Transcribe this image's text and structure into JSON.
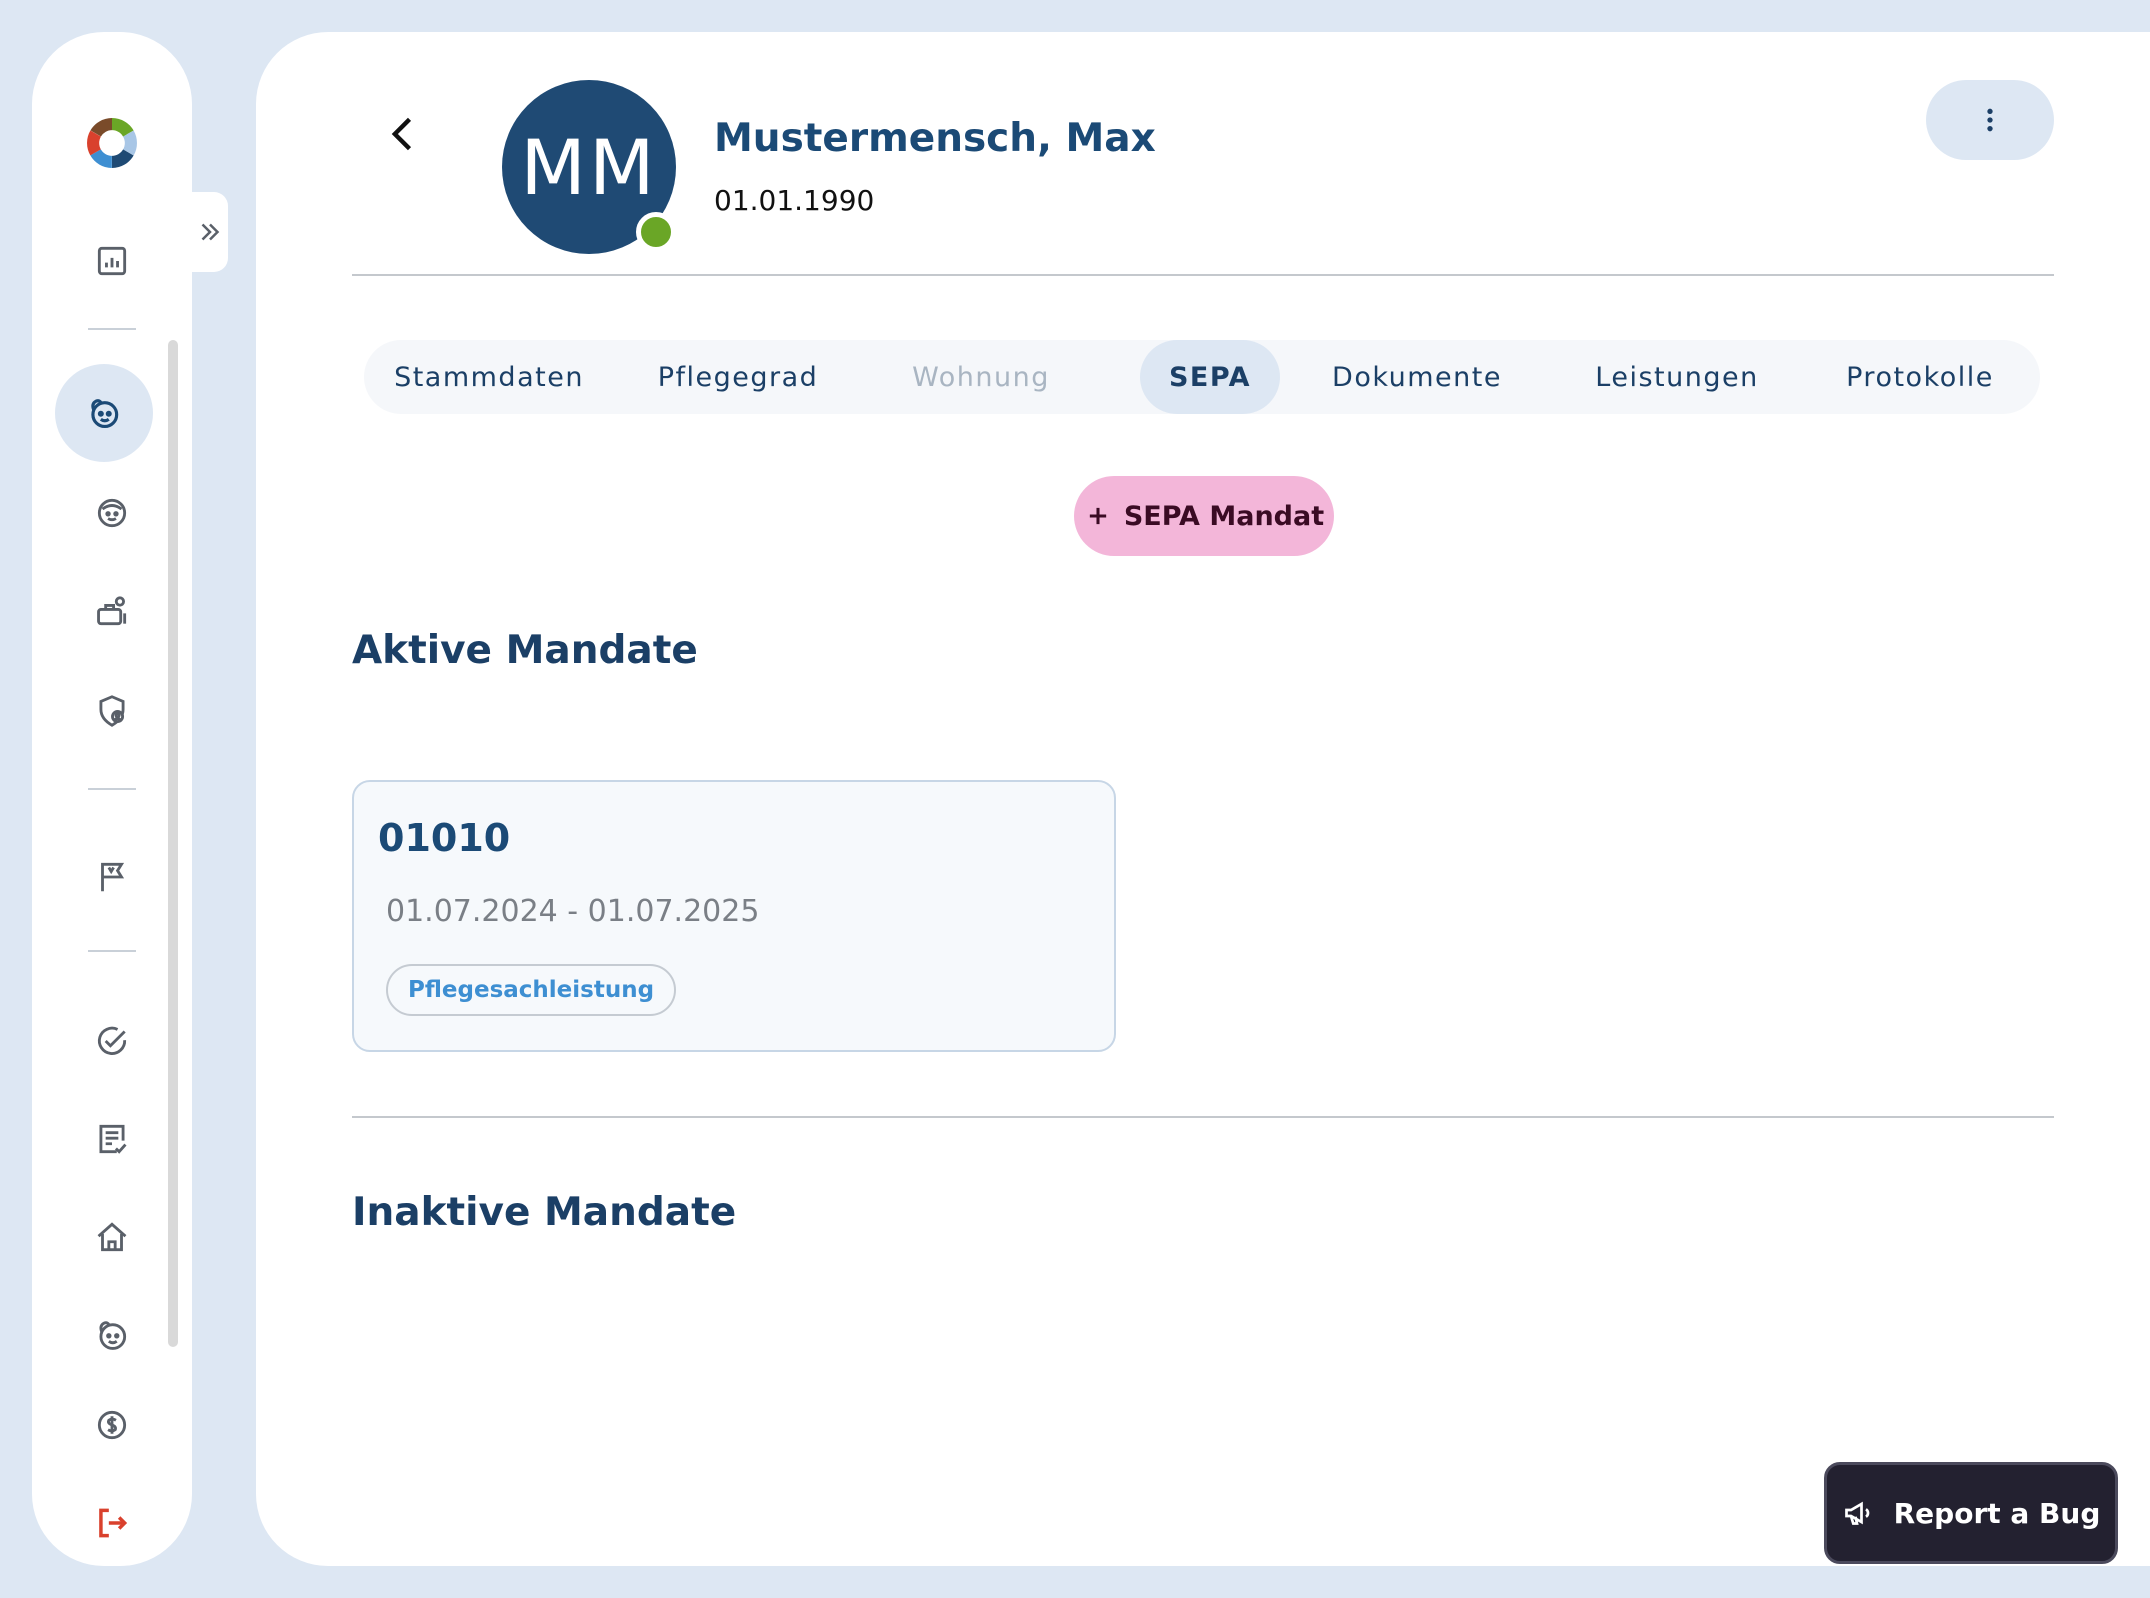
{
  "sidebar": {
    "items": [
      {
        "name": "app-logo",
        "icon": "logo-ring"
      },
      {
        "name": "dashboard",
        "icon": "chart-icon"
      },
      {
        "name": "clients",
        "icon": "face-icon",
        "active": true
      },
      {
        "name": "contacts",
        "icon": "face-outline-icon"
      },
      {
        "name": "caregivers",
        "icon": "briefcase-user-icon"
      },
      {
        "name": "insurance",
        "icon": "shield-user-icon"
      },
      {
        "name": "flags",
        "icon": "flag-icon"
      },
      {
        "name": "tasks",
        "icon": "check-circle-icon"
      },
      {
        "name": "lists",
        "icon": "checklist-icon"
      },
      {
        "name": "housing",
        "icon": "house-icon"
      },
      {
        "name": "persons",
        "icon": "face-icon"
      },
      {
        "name": "billing",
        "icon": "dollar-circle-icon"
      },
      {
        "name": "logout",
        "icon": "logout-icon"
      }
    ],
    "active_color": "#1b4a76",
    "logout_color": "#d9412d"
  },
  "header": {
    "avatar_initials": "MM",
    "name": "Mustermensch, Max",
    "dob": "01.01.1990",
    "status_color": "#6aa626"
  },
  "tabs": [
    {
      "label": "Stammdaten",
      "state": "normal"
    },
    {
      "label": "Pflegegrad",
      "state": "normal"
    },
    {
      "label": "Wohnung",
      "state": "disabled"
    },
    {
      "label": "SEPA",
      "state": "active"
    },
    {
      "label": "Dokumente",
      "state": "normal"
    },
    {
      "label": "Leistungen",
      "state": "normal"
    },
    {
      "label": "Protokolle",
      "state": "normal"
    }
  ],
  "sepa": {
    "add_button_label": "SEPA Mandat",
    "active_title": "Aktive Mandate",
    "inactive_title": "Inaktive Mandate",
    "active_mandates": [
      {
        "id": "01010",
        "date_range": "01.07.2024 - 01.07.2025",
        "tag": "Pflegesachleistung"
      }
    ]
  },
  "report_bug": {
    "label": "Report a Bug"
  }
}
